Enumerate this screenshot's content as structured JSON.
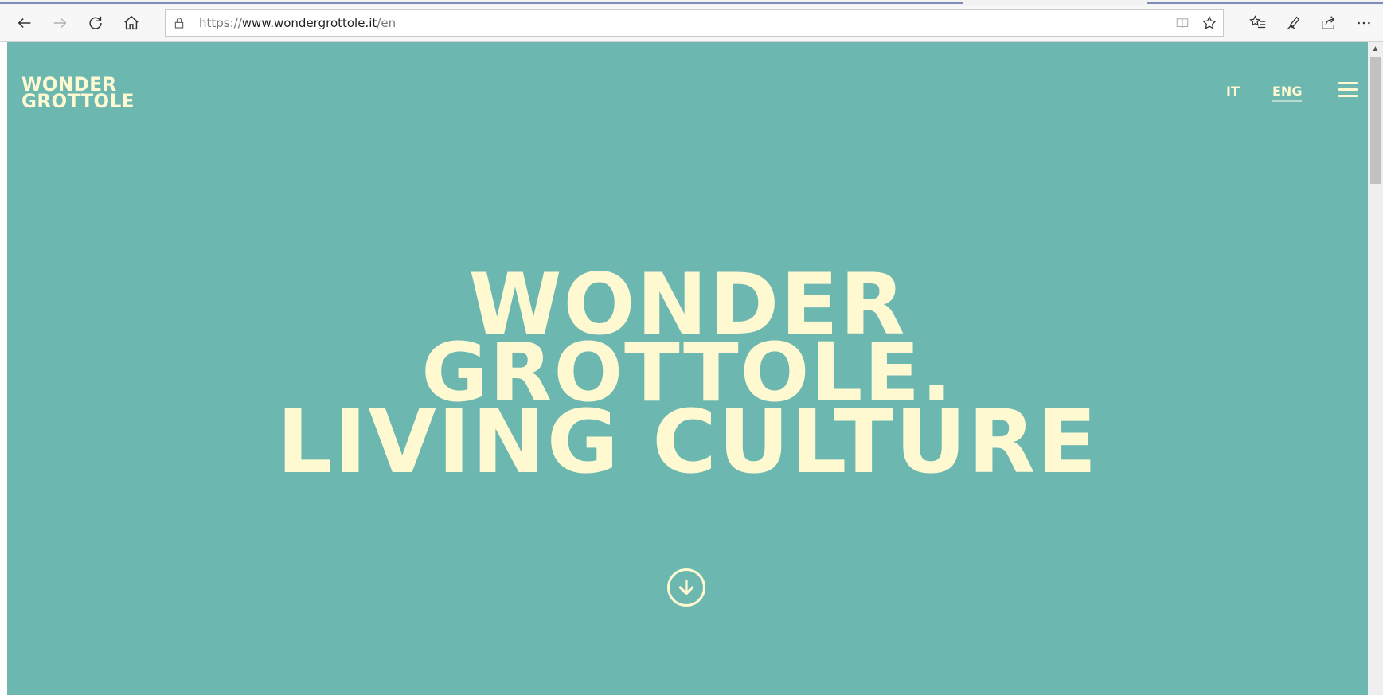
{
  "browser": {
    "url_prefix": "https://",
    "url_main": "www.wondergrottole.it",
    "url_path": "/en"
  },
  "site": {
    "logo_line1": "WONDER",
    "logo_line2": "GROTTOLE",
    "lang_it": "IT",
    "lang_eng": "ENG",
    "hero_line1": "WONDER",
    "hero_line2": "GROTTOLE.",
    "hero_line3": "LIVING CULTURE"
  },
  "colors": {
    "background": "#6cb8b1",
    "text": "#fff9d2"
  }
}
